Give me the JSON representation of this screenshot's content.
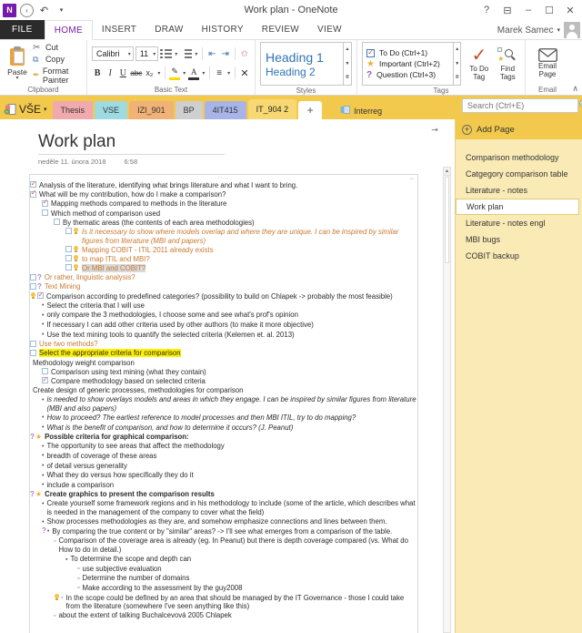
{
  "window": {
    "title": "Work plan - OneNote",
    "logo": "onenote-logo",
    "back_icon": "back-arrow-icon",
    "undo_icon": "undo-icon",
    "qat_more_icon": "qat-more-icon",
    "help": "?",
    "ribbon_display": "ribbon-display-options-icon",
    "minimize": "–",
    "maximize": "❐",
    "close": "✕",
    "user_name": "Marek Samec",
    "user_caret": "▾"
  },
  "ribbon": {
    "tabs": [
      {
        "label": "FILE",
        "active": false,
        "file": true
      },
      {
        "label": "HOME",
        "active": true
      },
      {
        "label": "INSERT",
        "active": false
      },
      {
        "label": "DRAW",
        "active": false
      },
      {
        "label": "HISTORY",
        "active": false
      },
      {
        "label": "REVIEW",
        "active": false
      },
      {
        "label": "VIEW",
        "active": false
      }
    ],
    "collapse_icon": "∧",
    "clipboard": {
      "group_label": "Clipboard",
      "paste_label": "Paste",
      "paste_caret": "▾",
      "cut_label": "Cut",
      "copy_label": "Copy",
      "format_painter_label": "Format Painter",
      "cut_icon": "✂",
      "copy_icon": "⧉",
      "format_painter_icon": "✒"
    },
    "basic_text": {
      "group_label": "Basic Text",
      "font_name": "Calibri",
      "font_size": "11",
      "caret": "▾",
      "bold": "B",
      "italic": "I",
      "underline": "U",
      "strikethrough": "abc",
      "subscript": "x₂",
      "bullets_icon": "bullets-icon",
      "numbering_icon": "numbering-icon",
      "decrease_indent_icon": "⇤",
      "increase_indent_icon": "⇥",
      "clear_formatting_icon": "⌇",
      "highlight_icon": "✐",
      "font_color_icon": "A",
      "align_icon": "≡",
      "remove_icon": "✕"
    },
    "styles": {
      "group_label": "Styles",
      "heading1": "Heading 1",
      "heading2": "Heading 2",
      "scroll_up": "▲",
      "scroll_down": "▼",
      "more": "≣"
    },
    "tags": {
      "group_label": "Tags",
      "items": [
        {
          "icon": "checkbox-icon",
          "label": "To Do (Ctrl+1)"
        },
        {
          "icon": "star-icon",
          "label": "Important (Ctrl+2)"
        },
        {
          "icon": "question-icon",
          "label": "Question (Ctrl+3)"
        }
      ],
      "to_do_tag_label": "To Do\nTag",
      "to_do_tag_line1": "To Do",
      "to_do_tag_line2": "Tag",
      "find_tags_line1": "Find",
      "find_tags_line2": "Tags",
      "scroll_up": "▲",
      "scroll_down": "▼",
      "more": "≣"
    },
    "email": {
      "group_label": "Email",
      "email_page_line1": "Email",
      "email_page_line2": "Page"
    }
  },
  "sections": {
    "notebook_name": "VŠE",
    "notebook_caret": "▾",
    "notebook_icon": "notebook-icon",
    "tabs": [
      {
        "label": "Thesis",
        "color": "#f0a9ad"
      },
      {
        "label": "VSE",
        "color": "#9edbe0"
      },
      {
        "label": "IZI_901",
        "color": "#f0b277"
      },
      {
        "label": "BP",
        "color": "#cfcfcf"
      },
      {
        "label": "4IT415",
        "color": "#a8b4e8"
      },
      {
        "label": "IT_904 2",
        "color": "#f7d873",
        "active": true
      }
    ],
    "new_section_label": "+",
    "other_notebook": "Interreg",
    "other_notebook_icon": "notebook-small-icon"
  },
  "search": {
    "placeholder": "Search (Ctrl+E)",
    "value": "",
    "icon": "search-icon",
    "caret": "▾"
  },
  "page": {
    "title": "Work plan",
    "date": "neděle 11. února 2018",
    "time": "6:58",
    "expand_icon": "expand-note-icon",
    "grip_dots": "····"
  },
  "page_list": {
    "add_page_label": "Add Page",
    "add_page_icon": "plus-circle-icon",
    "items": [
      {
        "label": "Comparison methodology",
        "active": false
      },
      {
        "label": "Catgegory comparison table",
        "active": false
      },
      {
        "label": "Literature - notes",
        "active": false
      },
      {
        "label": "Work plan",
        "active": true
      },
      {
        "label": "Literature - notes engl",
        "active": false
      },
      {
        "label": "MBI bugs",
        "active": false
      },
      {
        "label": "COBIT backup",
        "active": false
      }
    ]
  },
  "notes": [
    {
      "indent": 0,
      "markers": [
        "checkbox-checked"
      ],
      "text": "Analysis of the literature, identifying what brings literature and what I want to bring."
    },
    {
      "indent": 0,
      "markers": [
        "checkbox-checked"
      ],
      "text": "What will be my contribution, how do I make a comparison?"
    },
    {
      "indent": 1,
      "markers": [
        "checkbox-checked"
      ],
      "text": "Mapping methods compared to methods in the literature"
    },
    {
      "indent": 1,
      "markers": [
        "checkbox"
      ],
      "text": "Which method of comparison used"
    },
    {
      "indent": 2,
      "markers": [
        "checkbox"
      ],
      "text": "By thematic areas (the contents of each area methodologies)"
    },
    {
      "indent": 3,
      "markers": [
        "checkbox",
        "bulb"
      ],
      "style": "ital orange",
      "text": "Is it necessary to show where models overlap and where they are unique. I can be inspired by similar figures from literature (MBI and papers)"
    },
    {
      "indent": 3,
      "markers": [
        "checkbox",
        "bulb"
      ],
      "style": "orange",
      "text": "Mapping COBIT - ITIL 2011 already exists"
    },
    {
      "indent": 3,
      "markers": [
        "checkbox",
        "bulb"
      ],
      "style": "orange",
      "text": "to map ITIL and MBI?"
    },
    {
      "indent": 3,
      "markers": [
        "checkbox",
        "bulb"
      ],
      "style": "orange",
      "highlight": "grey",
      "text": "Or MBI and COBIT?"
    },
    {
      "indent": 0,
      "markers": [
        "checkbox",
        "question"
      ],
      "style": "orange",
      "text": "Or rather, linguistic analysis?"
    },
    {
      "indent": 0,
      "markers": [
        "checkbox",
        "question"
      ],
      "style": "orange",
      "text": "Text Mining"
    },
    {
      "indent": 0,
      "markers": [
        "bulb",
        "checkbox-checked"
      ],
      "text": "Comparison according to predefined categories? (possibility to build on Chlapek -> probably the most feasible)"
    },
    {
      "indent": 1,
      "markers": [
        "bullet-dot"
      ],
      "text": "Select the criteria that I will use"
    },
    {
      "indent": 1,
      "markers": [
        "bullet-dot"
      ],
      "text": "only compare the 3 methodologies, I choose some and see what's prof's opinion"
    },
    {
      "indent": 1,
      "markers": [
        "bullet-dot"
      ],
      "text": "If necessary  I can add other criteria used by other authors (to make it more objective)"
    },
    {
      "indent": 1,
      "markers": [
        "bullet-dot"
      ],
      "text": "Use the text mining tools to quantify the selected criteria (Kelemen et. al. 2013)"
    },
    {
      "indent": 0,
      "markers": [
        "checkbox"
      ],
      "style": "orange",
      "text": "Use two methods?"
    },
    {
      "indent": 0,
      "markers": [
        "checkbox"
      ],
      "highlight": "yellow",
      "text": "Select the appropriate criteria for comparison"
    },
    {
      "indent": 0,
      "markers": [],
      "text": "Methodology weight comparison"
    },
    {
      "indent": 1,
      "markers": [
        "checkbox"
      ],
      "text": "Comparison using text mining (what they contain)"
    },
    {
      "indent": 1,
      "markers": [
        "checkbox-checked"
      ],
      "text": "Compare methodology based on selected criteria"
    },
    {
      "indent": 0,
      "markers": [],
      "text": "Create design of generic processes, methodologies for comparison"
    },
    {
      "indent": 1,
      "markers": [
        "bullet-dot"
      ],
      "style": "ital",
      "text": "is needed to show overlays models and areas in which they engage. I can be inspired by similar figures from literature (MBI and also papers)"
    },
    {
      "indent": 1,
      "markers": [
        "bullet-dot"
      ],
      "style": "ital",
      "text": "How to proceed? The earliest reference to model processes and then MBI ITIL, try to do mapping?"
    },
    {
      "indent": 1,
      "markers": [
        "bullet-dot"
      ],
      "style": "ital",
      "text": "What is the benefit of comparison, and how to determine it occurs? (J. Peanut)"
    },
    {
      "indent": 0,
      "markers": [
        "question",
        "star"
      ],
      "style": "bold",
      "text": "Possible criteria for graphical comparison:"
    },
    {
      "indent": 1,
      "markers": [
        "bullet-dot"
      ],
      "text": "The opportunity to see areas that affect the methodology"
    },
    {
      "indent": 1,
      "markers": [
        "bullet-dot"
      ],
      "text": "breadth of coverage of these areas"
    },
    {
      "indent": 1,
      "markers": [
        "bullet-dot"
      ],
      "text": "of detail versus generality"
    },
    {
      "indent": 1,
      "markers": [
        "bullet-dot"
      ],
      "text": "What they do versus how specifically they do it"
    },
    {
      "indent": 1,
      "markers": [
        "bullet-dot"
      ],
      "text": "include a comparison"
    },
    {
      "indent": 0,
      "markers": [
        "question",
        "star"
      ],
      "style": "bold",
      "text": "Create graphics to present the comparison results"
    },
    {
      "indent": 1,
      "markers": [
        "bullet-dot"
      ],
      "text": "Create yourself some framework regions and in his methodology to include (some of the article, which describes what is needed in the management of the company to cover what the field)"
    },
    {
      "indent": 1,
      "markers": [
        "bullet-dot"
      ],
      "text": "Show processes methodologies as they are, and somehow emphasize connections and lines between them."
    },
    {
      "indent": 1,
      "markers": [
        "question",
        "bullet-dot"
      ],
      "text": "By comparing the true content or by \"similar\" areas? -> I'll see what emerges from a comparison of the table."
    },
    {
      "indent": 2,
      "markers": [
        "bullet-circle"
      ],
      "text": "Comparison of the coverage area is already (eg. In Peanut) but there is depth coverage compared (vs. What do How to do in detail.)"
    },
    {
      "indent": 3,
      "markers": [
        "bullet-square"
      ],
      "text": "To determine the scope and depth can"
    },
    {
      "indent": 4,
      "markers": [
        "bullet-opensquare"
      ],
      "text": "use subjective evaluation"
    },
    {
      "indent": 4,
      "markers": [
        "bullet-opensquare"
      ],
      "text": "Determine the number of domains"
    },
    {
      "indent": 4,
      "markers": [
        "bullet-opensquare"
      ],
      "text": "Make according to the assessment by the guy2008"
    },
    {
      "indent": 2,
      "markers": [
        "bulb",
        "bullet-circle"
      ],
      "text": "In the scope could be defined by an area that should be managed by the IT Governance - those I could take from the literature (somewhere I've seen anything like this)"
    },
    {
      "indent": 2,
      "markers": [
        "bullet-circle"
      ],
      "text": "about the extent of talking Buchalcevová 2005 Chlapek"
    }
  ],
  "colors": {
    "accent_purple": "#7719aa",
    "section_bar": "#f2c94c",
    "page_list_bg": "#faebb6",
    "highlight_yellow": "#fff200",
    "orange_text": "#c77b30"
  }
}
